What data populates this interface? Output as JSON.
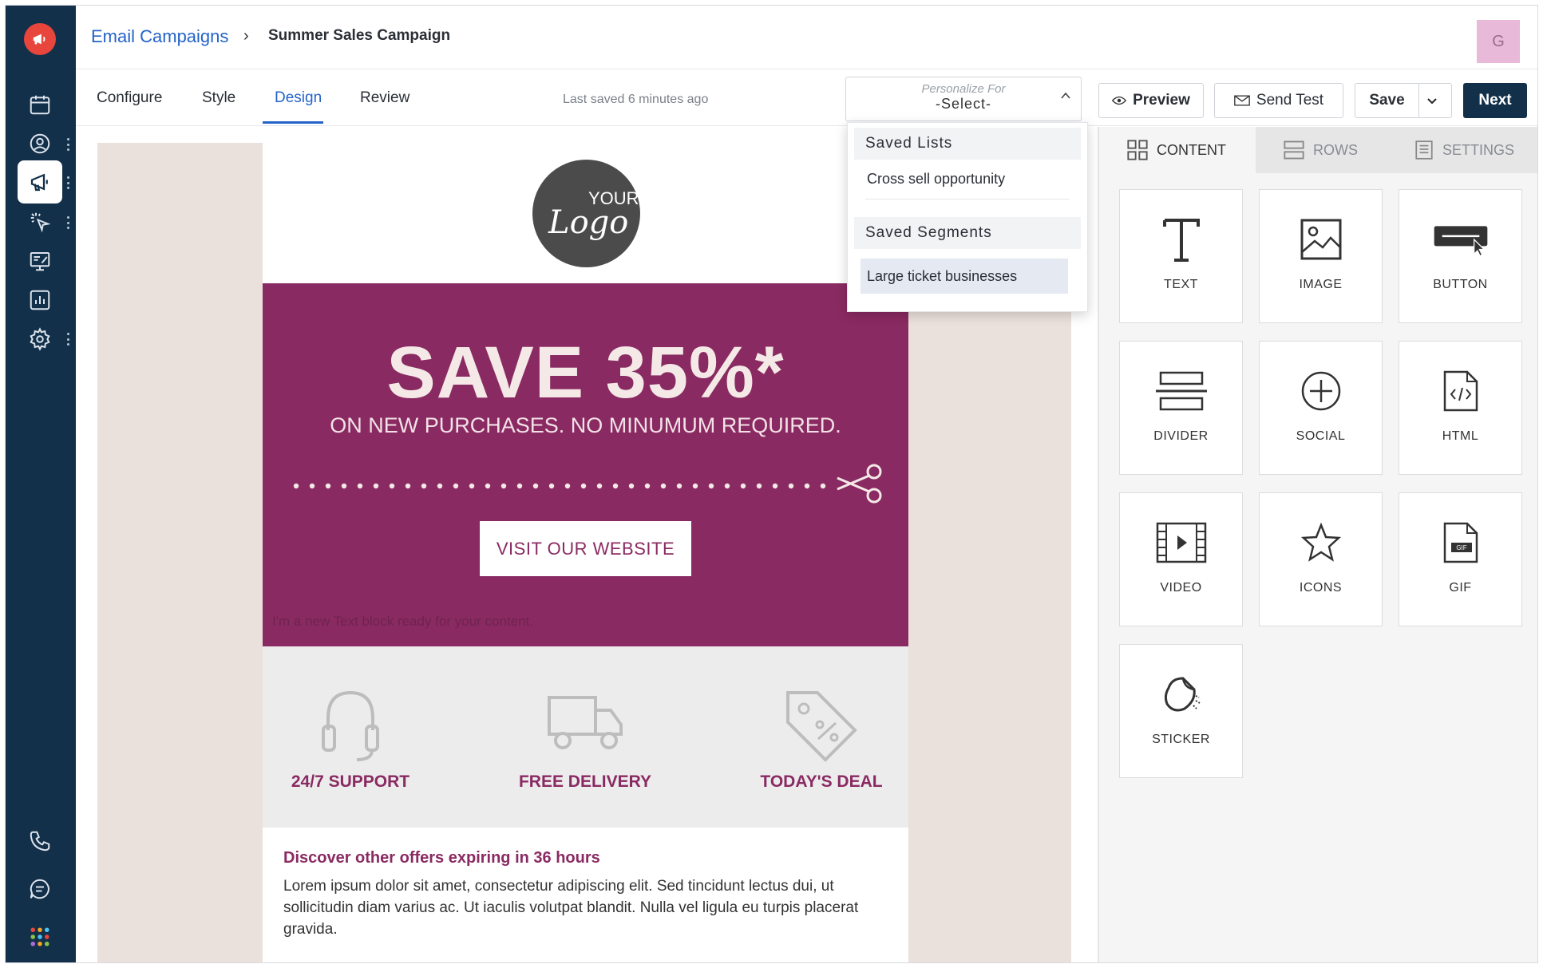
{
  "header": {
    "breadcrumb_root": "Email Campaigns",
    "breadcrumb_sep": "›",
    "breadcrumb_current": "Summer Sales Campaign",
    "avatar_initial": "G"
  },
  "toolbar": {
    "tabs": [
      "Configure",
      "Style",
      "Design",
      "Review"
    ],
    "active_tab": "Design",
    "last_saved": "Last saved 6 minutes ago",
    "personalize_label": "Personalize For",
    "personalize_value": "-Select-",
    "preview_label": "Preview",
    "send_test_label": "Send Test",
    "save_label": "Save",
    "next_label": "Next"
  },
  "dropdown": {
    "groups": [
      {
        "label": "Saved Lists",
        "items": [
          "Cross sell opportunity"
        ]
      },
      {
        "label": "Saved Segments",
        "items": [
          "Large ticket businesses"
        ]
      }
    ]
  },
  "email": {
    "logo_top": "YOUR",
    "logo_bottom": "Logo",
    "hero_title": "SAVE 35%*",
    "hero_subtitle": "ON NEW PURCHASES. NO MINUMUM REQUIRED.",
    "cta_label": "VISIT OUR WEBSITE",
    "placeholder_text": "I'm a new Text block ready for your content.",
    "features": [
      {
        "icon": "headset-icon",
        "label": "24/7 SUPPORT"
      },
      {
        "icon": "truck-icon",
        "label": "FREE DELIVERY"
      },
      {
        "icon": "tag-icon",
        "label": "TODAY'S DEAL"
      }
    ],
    "offer_title": "Discover other offers expiring in 36 hours",
    "offer_body": "Lorem ipsum dolor sit amet, consectetur adipiscing elit. Sed tincidunt lectus dui, ut sollicitudin diam varius ac. Ut iaculis volutpat blandit. Nulla vel ligula eu turpis placerat gravida."
  },
  "panel": {
    "tabs": [
      "CONTENT",
      "ROWS",
      "SETTINGS"
    ],
    "active_tab": "CONTENT",
    "blocks": [
      "TEXT",
      "IMAGE",
      "BUTTON",
      "DIVIDER",
      "SOCIAL",
      "HTML",
      "VIDEO",
      "ICONS",
      "GIF",
      "STICKER"
    ]
  },
  "colors": {
    "sidebar": "#13304a",
    "brand_accent": "#e8453c",
    "link_blue": "#2463c9",
    "hero": "#8a2a62",
    "avatar": "#e8b9d8"
  }
}
